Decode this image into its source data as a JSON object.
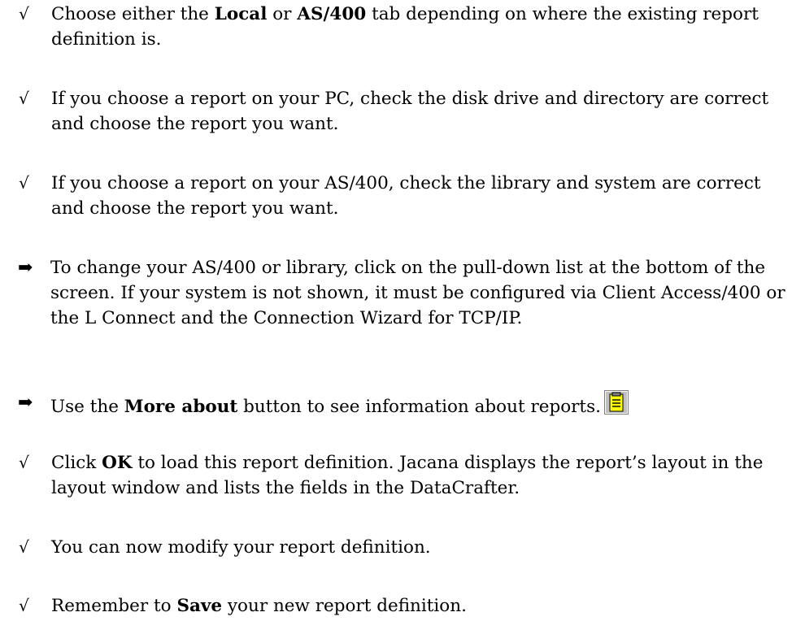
{
  "markers": {
    "check": "√",
    "arrow": "➡"
  },
  "items": [
    {
      "type": "check",
      "parts": [
        {
          "t": "Choose either the "
        },
        {
          "t": "Local",
          "b": true
        },
        {
          "t": " or "
        },
        {
          "t": "AS/400",
          "b": true
        },
        {
          "t": " tab depending on where the existing report definition is."
        }
      ]
    },
    {
      "type": "check",
      "parts": [
        {
          "t": "If you choose a report on your PC, check the disk drive and directory are correct and choose the report you want."
        }
      ]
    },
    {
      "type": "check",
      "parts": [
        {
          "t": "If you choose a report on your AS/400, check the library and system are correct and choose the report you want."
        }
      ]
    },
    {
      "type": "arrow",
      "parts": [
        {
          "t": "To change your AS/400 or library, click on the pull-down list at the bottom of the screen. If your system is not shown, it must be configured via Client Access/400 or the L Connect and the Connection Wizard for TCP/IP."
        }
      ]
    },
    {
      "type": "arrow",
      "icon": "notepad-icon",
      "parts": [
        {
          "t": "Use the "
        },
        {
          "t": "More about",
          "b": true
        },
        {
          "t": " button to see information about reports."
        }
      ]
    },
    {
      "type": "check",
      "parts": [
        {
          "t": "Click "
        },
        {
          "t": "OK",
          "b": true
        },
        {
          "t": " to load this report definition. Jacana displays the report’s layout in the layout window and lists the fields in the DataCrafter."
        }
      ]
    },
    {
      "type": "check",
      "parts": [
        {
          "t": "You can now modify your report definition."
        }
      ]
    },
    {
      "type": "check",
      "parts": [
        {
          "t": "Remember to "
        },
        {
          "t": "Save",
          "b": true
        },
        {
          "t": " your new report definition."
        }
      ]
    }
  ]
}
